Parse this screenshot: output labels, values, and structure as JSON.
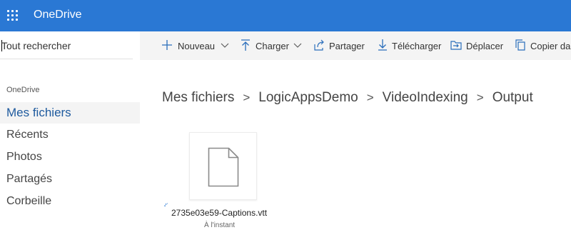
{
  "app": {
    "title": "OneDrive"
  },
  "search": {
    "placeholder": "Tout rechercher"
  },
  "nav": {
    "section_label": "OneDrive",
    "items": [
      {
        "label": "Mes fichiers"
      },
      {
        "label": "Récents"
      },
      {
        "label": "Photos"
      },
      {
        "label": "Partagés"
      },
      {
        "label": "Corbeille"
      }
    ]
  },
  "commands": {
    "new": "Nouveau",
    "upload": "Charger",
    "share": "Partager",
    "download": "Télécharger",
    "move": "Déplacer",
    "copy": "Copier da"
  },
  "breadcrumb": [
    "Mes fichiers",
    "LogicAppsDemo",
    "VideoIndexing",
    "Output"
  ],
  "file": {
    "name": "2735e03e59-Captions.vtt",
    "modified": "À l'instant"
  },
  "colors": {
    "brand": "#2a78d4",
    "accent_icon": "#2a6ebb",
    "selected_text": "#1e5a9e"
  }
}
